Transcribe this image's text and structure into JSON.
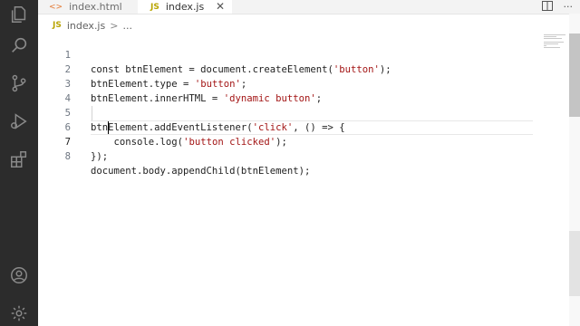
{
  "tabs": [
    {
      "icon": "<>",
      "label": "index.html"
    },
    {
      "icon": "JS",
      "label": "index.js",
      "close": "✕"
    }
  ],
  "breadcrumb": {
    "icon": "JS",
    "file": "index.js",
    "sep": ">",
    "more": "..."
  },
  "colors": {
    "activity_bar": "#2c2c2c",
    "string": "#a31515",
    "html_icon": "#e37933",
    "js_icon": "#b8a400"
  },
  "editor": {
    "lines": [
      {
        "num": "1",
        "text": "const btnElement = document.createElement('button');"
      },
      {
        "num": "2",
        "text": "btnElement.type = 'button';"
      },
      {
        "num": "3",
        "text": "btnElement.innerHTML = 'dynamic button';"
      },
      {
        "num": "4",
        "text": ""
      },
      {
        "num": "5",
        "text": "btnElement.addEventListener('click', () => {"
      },
      {
        "num": "6",
        "text": "    console.log('button clicked');"
      },
      {
        "num": "7",
        "text": "});"
      },
      {
        "num": "8",
        "text": "document.body.appendChild(btnElement);"
      }
    ],
    "current_line": 7
  },
  "activity_bar": [
    "files-icon",
    "search-icon",
    "source-control-icon",
    "run-debug-icon",
    "extensions-icon",
    "account-icon",
    "settings-gear-icon"
  ]
}
